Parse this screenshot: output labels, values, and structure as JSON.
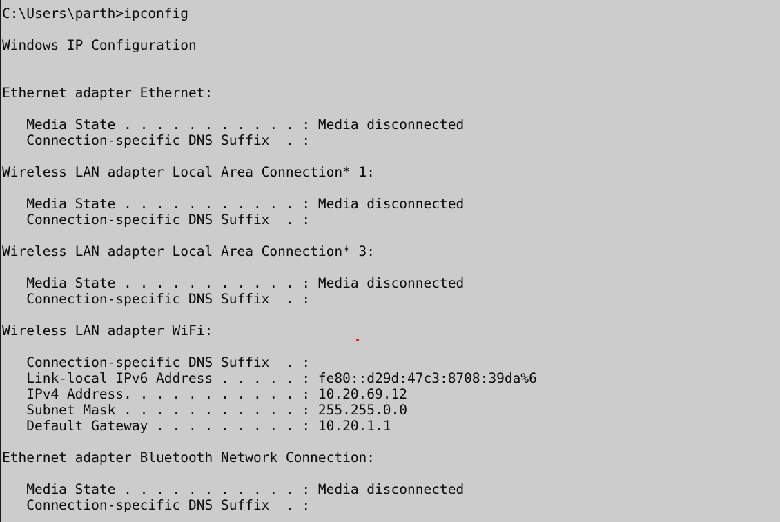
{
  "terminal": {
    "lines": [
      "C:\\Users\\parth>ipconfig",
      "Windows IP Configuration",
      "Ethernet adapter Ethernet:",
      "   Media State . . . . . . . . . . . : Media disconnected",
      "   Connection-specific DNS Suffix  . :",
      "Wireless LAN adapter Local Area Connection* 1:",
      "   Media State . . . . . . . . . . . : Media disconnected",
      "   Connection-specific DNS Suffix  . :",
      "Wireless LAN adapter Local Area Connection* 3:",
      "   Media State . . . . . . . . . . . : Media disconnected",
      "   Connection-specific DNS Suffix  . :",
      "Wireless LAN adapter WiFi:",
      "   Connection-specific DNS Suffix  . :",
      "   Link-local IPv6 Address . . . . . : fe80::d29d:47c3:8708:39da%6",
      "   IPv4 Address. . . . . . . . . . . : 10.20.69.12",
      "   Subnet Mask . . . . . . . . . . . : 255.255.0.0",
      "   Default Gateway . . . . . . . . . : 10.20.1.1",
      "Ethernet adapter Bluetooth Network Connection:",
      "   Media State . . . . . . . . . . . : Media disconnected",
      "   Connection-specific DNS Suffix  . :"
    ]
  },
  "colors": {
    "background": "#cccccc",
    "text": "#0c0c0c",
    "pointer_dot": "#d81b1b"
  }
}
